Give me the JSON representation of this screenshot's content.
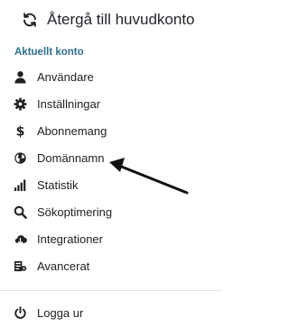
{
  "header": {
    "back_label": "Återgå till huvudkonto",
    "back_icon": "refresh-icon"
  },
  "section": {
    "label": "Aktuellt konto"
  },
  "menu": {
    "items": [
      {
        "label": "Användare",
        "icon": "user-icon"
      },
      {
        "label": "Inställningar",
        "icon": "gear-icon"
      },
      {
        "label": "Abonnemang",
        "icon": "dollar-icon"
      },
      {
        "label": "Domännamn",
        "icon": "globe-icon"
      },
      {
        "label": "Statistik",
        "icon": "bar-chart-icon"
      },
      {
        "label": "Sökoptimering",
        "icon": "search-icon"
      },
      {
        "label": "Integrationer",
        "icon": "cloud-icon"
      },
      {
        "label": "Avancerat",
        "icon": "advanced-icon"
      }
    ]
  },
  "footer": {
    "logout_label": "Logga ur",
    "logout_icon": "power-icon"
  },
  "colors": {
    "section_label": "#2e6e8e",
    "text": "#1f2328",
    "divider": "#e1e4e8"
  }
}
